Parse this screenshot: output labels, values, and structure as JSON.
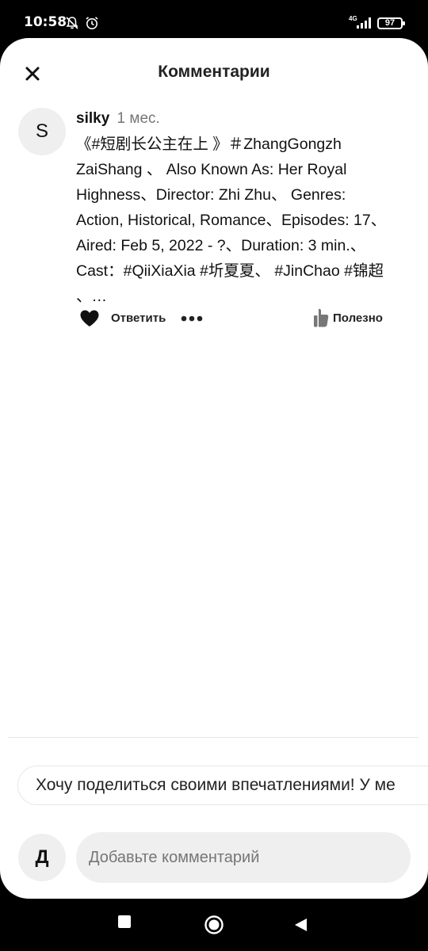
{
  "status_bar": {
    "time": "10:58",
    "network": "4G",
    "battery": "97"
  },
  "header": {
    "title": "Комментарии"
  },
  "comment": {
    "avatar_letter": "S",
    "username": "silky",
    "time_ago": "1 мес.",
    "text": "《#短剧长公主在上 》＃ZhangGongzh ZaiShang 、 Also Known As: Her Royal Highness、Director: Zhi Zhu、 Genres: Action, Historical, Romance、Episodes: 17、 Aired: Feb 5, 2022 - ?、Duration: 3 min.、 Cast：#QiiXiaXia #圻夏夏、 #JinChao #锦超 、…",
    "reply_label": "Ответить",
    "helpful_label": "Полезно"
  },
  "suggestion": {
    "text": "Хочу поделиться своими впечатлениями! У ме"
  },
  "composer": {
    "avatar_letter": "Д",
    "placeholder": "Добавьте комментарий"
  },
  "icons": {
    "close": "close-icon",
    "like": "heart-icon",
    "more": "more-dots-icon",
    "helpful": "thumbs-up-icon",
    "nav_recent": "square-icon",
    "nav_home": "circle-icon",
    "nav_back": "triangle-back-icon"
  }
}
